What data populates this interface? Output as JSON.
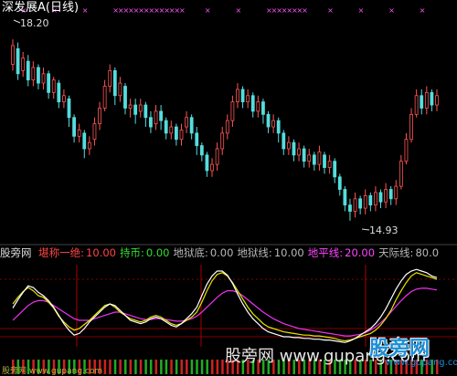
{
  "chart_title": "深发展A(日线)",
  "price_high_label": "18.20",
  "price_low_label": "14.93",
  "indicators": {
    "name": "股旁网",
    "items": [
      {
        "label": "堪称一绝:",
        "value": "10.00",
        "color": "#ff4444"
      },
      {
        "label": "持币:",
        "value": "0.00",
        "color": "#33dd33"
      },
      {
        "label": "地狱底:",
        "value": "0.00",
        "color": "#b8b8b8"
      },
      {
        "label": "地狱线:",
        "value": "10.00",
        "color": "#b8b8b8"
      },
      {
        "label": "地平线:",
        "value": "20.00",
        "color": "#ff44ff"
      },
      {
        "label": "天际线:",
        "value": "80.0",
        "color": "#b8b8b8"
      }
    ]
  },
  "watermark": "股旁网 www.gupang.com",
  "logo_text": "股旁网",
  "logo_url": "www.gupang.com",
  "bottom_caption": "股旁网 www.gupang.com",
  "colors": {
    "up": "#ff5555",
    "down": "#55dddd",
    "white_line": "#ffffff",
    "yellow_line": "#e6e600",
    "magenta_line": "#ee33ee",
    "grid_red": "#aa0000",
    "marker": "#ff55ff"
  },
  "chart_data": {
    "type": "candlestick",
    "price_range": [
      14.93,
      18.2
    ],
    "indicator_range": [
      0,
      100
    ],
    "candles": [
      [
        17.55,
        17.85,
        17.95,
        17.45
      ],
      [
        17.8,
        17.4,
        17.9,
        17.3
      ],
      [
        17.45,
        17.65,
        17.75,
        17.35
      ],
      [
        17.6,
        17.3,
        17.7,
        17.2
      ],
      [
        17.3,
        17.5,
        17.6,
        17.2
      ],
      [
        17.5,
        17.25,
        17.55,
        17.15
      ],
      [
        17.25,
        17.4,
        17.5,
        17.15
      ],
      [
        17.4,
        17.1,
        17.45,
        17.0
      ],
      [
        17.1,
        17.3,
        17.35,
        17.0
      ],
      [
        17.25,
        16.95,
        17.3,
        16.85
      ],
      [
        16.95,
        17.05,
        17.15,
        16.85
      ],
      [
        17.0,
        16.7,
        17.05,
        16.55
      ],
      [
        16.7,
        16.4,
        16.75,
        16.3
      ],
      [
        16.4,
        16.5,
        16.6,
        16.3
      ],
      [
        16.45,
        16.2,
        16.5,
        16.05
      ],
      [
        16.2,
        16.3,
        16.4,
        16.1
      ],
      [
        16.35,
        16.6,
        16.7,
        16.25
      ],
      [
        16.6,
        16.85,
        16.95,
        16.5
      ],
      [
        16.85,
        17.2,
        17.3,
        16.8
      ],
      [
        17.2,
        17.45,
        17.55,
        17.1
      ],
      [
        17.45,
        17.05,
        17.5,
        16.9
      ],
      [
        17.05,
        17.25,
        17.35,
        16.95
      ],
      [
        17.2,
        16.85,
        17.25,
        16.75
      ],
      [
        16.85,
        16.9,
        17.0,
        16.7
      ],
      [
        16.9,
        16.75,
        17.0,
        16.6
      ],
      [
        16.8,
        16.9,
        17.0,
        16.7
      ],
      [
        16.9,
        16.7,
        16.95,
        16.55
      ],
      [
        16.7,
        16.55,
        16.8,
        16.45
      ],
      [
        16.6,
        16.8,
        16.9,
        16.5
      ],
      [
        16.8,
        16.65,
        16.9,
        16.5
      ],
      [
        16.65,
        16.45,
        16.7,
        16.35
      ],
      [
        16.45,
        16.55,
        16.65,
        16.35
      ],
      [
        16.55,
        16.35,
        16.6,
        16.25
      ],
      [
        16.35,
        16.5,
        16.6,
        16.25
      ],
      [
        16.55,
        16.7,
        16.8,
        16.45
      ],
      [
        16.7,
        16.45,
        16.75,
        16.35
      ],
      [
        16.45,
        16.25,
        16.55,
        16.1
      ],
      [
        16.25,
        16.1,
        16.3,
        16.0
      ],
      [
        16.1,
        15.85,
        16.15,
        15.75
      ],
      [
        15.85,
        15.95,
        16.05,
        15.75
      ],
      [
        15.95,
        16.2,
        16.3,
        15.85
      ],
      [
        16.2,
        16.45,
        16.55,
        16.1
      ],
      [
        16.45,
        16.65,
        16.75,
        16.35
      ],
      [
        16.65,
        16.95,
        17.05,
        16.55
      ],
      [
        16.95,
        17.15,
        17.25,
        16.85
      ],
      [
        17.15,
        16.95,
        17.2,
        16.85
      ],
      [
        16.95,
        17.05,
        17.15,
        16.85
      ],
      [
        17.05,
        16.8,
        17.1,
        16.7
      ],
      [
        16.8,
        16.95,
        17.05,
        16.7
      ],
      [
        16.95,
        16.75,
        17.0,
        16.6
      ],
      [
        16.75,
        16.55,
        16.8,
        16.45
      ],
      [
        16.55,
        16.65,
        16.75,
        16.45
      ],
      [
        16.65,
        16.45,
        16.7,
        16.3
      ],
      [
        16.45,
        16.2,
        16.5,
        16.1
      ],
      [
        16.2,
        16.3,
        16.4,
        16.1
      ],
      [
        16.3,
        16.1,
        16.35,
        16.0
      ],
      [
        16.1,
        16.2,
        16.3,
        16.0
      ],
      [
        16.2,
        16.0,
        16.25,
        15.9
      ],
      [
        16.0,
        16.1,
        16.2,
        15.9
      ],
      [
        16.1,
        15.95,
        16.15,
        15.85
      ],
      [
        15.95,
        16.15,
        16.25,
        15.85
      ],
      [
        16.1,
        15.9,
        16.15,
        15.8
      ],
      [
        15.9,
        16.0,
        16.1,
        15.8
      ],
      [
        16.0,
        15.75,
        16.05,
        15.65
      ],
      [
        15.75,
        15.55,
        15.8,
        15.45
      ],
      [
        15.55,
        15.3,
        15.6,
        15.2
      ],
      [
        15.3,
        15.2,
        15.4,
        15.05
      ],
      [
        15.2,
        15.4,
        15.5,
        15.1
      ],
      [
        15.4,
        15.25,
        15.45,
        15.15
      ],
      [
        15.25,
        15.45,
        15.55,
        15.15
      ],
      [
        15.45,
        15.3,
        15.5,
        15.2
      ],
      [
        15.3,
        15.5,
        15.6,
        15.2
      ],
      [
        15.5,
        15.35,
        15.55,
        15.25
      ],
      [
        15.35,
        15.55,
        15.65,
        15.25
      ],
      [
        15.55,
        15.4,
        15.6,
        15.3
      ],
      [
        15.4,
        15.6,
        15.7,
        15.3
      ],
      [
        15.6,
        16.0,
        16.1,
        15.55
      ],
      [
        16.0,
        16.35,
        16.45,
        15.95
      ],
      [
        16.35,
        16.75,
        16.85,
        16.3
      ],
      [
        16.75,
        17.05,
        17.15,
        16.7
      ],
      [
        17.05,
        16.85,
        17.15,
        16.75
      ],
      [
        16.85,
        17.1,
        17.2,
        16.75
      ],
      [
        17.1,
        16.9,
        17.15,
        16.8
      ],
      [
        16.9,
        17.05,
        17.15,
        16.8
      ]
    ],
    "indicator_lines": {
      "yellow": [
        50,
        58,
        65,
        70,
        66,
        60,
        58,
        52,
        45,
        35,
        28,
        22,
        18,
        20,
        25,
        30,
        36,
        42,
        48,
        50,
        46,
        40,
        36,
        32,
        30,
        28,
        30,
        34,
        36,
        34,
        30,
        26,
        24,
        26,
        30,
        34,
        40,
        52,
        66,
        78,
        86,
        88,
        84,
        76,
        66,
        56,
        46,
        38,
        32,
        26,
        22,
        20,
        18,
        16,
        15,
        14,
        13,
        12,
        12,
        11,
        11,
        10,
        9,
        8,
        6,
        5,
        6,
        8,
        10,
        12,
        14,
        18,
        24,
        32,
        42,
        55,
        66,
        76,
        84,
        88,
        86,
        84,
        82,
        80
      ],
      "white": [
        45,
        55,
        64,
        72,
        70,
        64,
        60,
        54,
        46,
        36,
        26,
        18,
        12,
        14,
        20,
        28,
        34,
        40,
        46,
        50,
        48,
        42,
        36,
        30,
        28,
        26,
        28,
        32,
        34,
        32,
        28,
        24,
        22,
        26,
        32,
        38,
        46,
        60,
        74,
        84,
        90,
        90,
        85,
        75,
        62,
        50,
        40,
        32,
        26,
        20,
        16,
        14,
        12,
        10,
        10,
        9,
        9,
        8,
        8,
        7,
        7,
        6,
        6,
        5,
        4,
        3,
        5,
        8,
        12,
        16,
        20,
        26,
        34,
        44,
        56,
        68,
        78,
        86,
        90,
        92,
        90,
        88,
        84,
        82
      ],
      "magenta": [
        30,
        36,
        42,
        48,
        52,
        54,
        54,
        52,
        48,
        44,
        40,
        36,
        32,
        30,
        30,
        30,
        32,
        34,
        36,
        38,
        40,
        40,
        38,
        36,
        34,
        32,
        31,
        31,
        32,
        32,
        31,
        30,
        29,
        29,
        30,
        32,
        35,
        40,
        46,
        52,
        58,
        63,
        66,
        66,
        64,
        60,
        55,
        50,
        45,
        40,
        36,
        32,
        29,
        26,
        24,
        22,
        20,
        19,
        18,
        17,
        16,
        15,
        14,
        13,
        12,
        11,
        11,
        12,
        13,
        15,
        18,
        22,
        27,
        33,
        40,
        47,
        54,
        60,
        65,
        68,
        69,
        69,
        68,
        67
      ]
    }
  }
}
